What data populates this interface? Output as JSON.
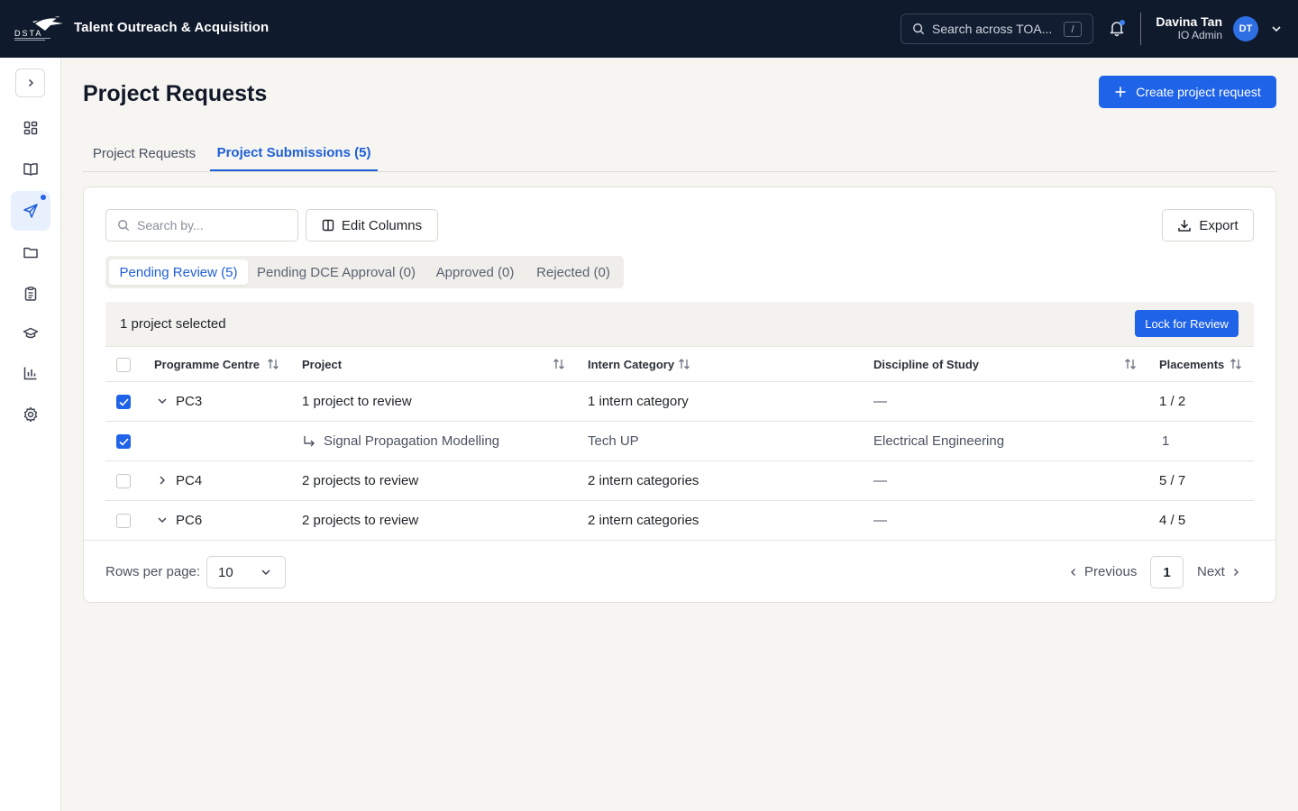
{
  "header": {
    "app_title": "Talent Outreach & Acquisition",
    "logo_text": "DSTA",
    "search_placeholder": "Search across TOA...",
    "search_shortcut": "/",
    "user_name": "Davina Tan",
    "user_role": "IO Admin",
    "user_initials": "DT"
  },
  "sidebar": {
    "items": [
      {
        "icon": "dashboard-icon",
        "active": false
      },
      {
        "icon": "book-icon",
        "active": false
      },
      {
        "icon": "send-icon",
        "active": true,
        "has_dot": true
      },
      {
        "icon": "folder-icon",
        "active": false
      },
      {
        "icon": "clipboard-icon",
        "active": false
      },
      {
        "icon": "graduation-cap-icon",
        "active": false
      },
      {
        "icon": "bar-chart-icon",
        "active": false
      },
      {
        "icon": "gear-icon",
        "active": false
      }
    ]
  },
  "page": {
    "title": "Project Requests",
    "create_button": "Create project request"
  },
  "tabs": [
    {
      "label": "Project Requests",
      "active": false
    },
    {
      "label": "Project Submissions (5)",
      "active": true
    }
  ],
  "toolbar": {
    "search_placeholder": "Search by...",
    "edit_columns": "Edit Columns",
    "export": "Export"
  },
  "status_filters": [
    {
      "label": "Pending Review (5)",
      "active": true
    },
    {
      "label": "Pending DCE Approval (0)",
      "active": false
    },
    {
      "label": "Approved (0)",
      "active": false
    },
    {
      "label": "Rejected (0)",
      "active": false
    }
  ],
  "bulk": {
    "selected_text": "1 project selected",
    "lock_button": "Lock for Review"
  },
  "table": {
    "columns": [
      "Programme Centre",
      "Project",
      "Intern Category",
      "Discipline of Study",
      "Placements"
    ],
    "rows": [
      {
        "checked": true,
        "expand": "down",
        "centre": "PC3",
        "project": "1 project to review",
        "category": "1 intern category",
        "discipline": "—",
        "placements": "1 / 2",
        "child": false
      },
      {
        "checked": true,
        "expand": "",
        "centre": "",
        "project": "Signal Propagation Modelling",
        "category": "Tech UP",
        "discipline": "Electrical Engineering",
        "placements": "1",
        "child": true
      },
      {
        "checked": false,
        "expand": "right",
        "centre": "PC4",
        "project": "2 projects to review",
        "category": "2 intern categories",
        "discipline": "—",
        "placements": "5 / 7",
        "child": false
      },
      {
        "checked": false,
        "expand": "down",
        "centre": "PC6",
        "project": "2 projects to review",
        "category": "2 intern categories",
        "discipline": "—",
        "placements": "4 / 5",
        "child": false
      }
    ]
  },
  "pagination": {
    "rows_per_page_label": "Rows per page:",
    "rows_per_page_value": "10",
    "previous": "Previous",
    "current_page": "1",
    "next": "Next"
  },
  "colors": {
    "topbar": "#0f1a2c",
    "accent": "#1f63e8",
    "page_bg": "#f6f5f2"
  }
}
